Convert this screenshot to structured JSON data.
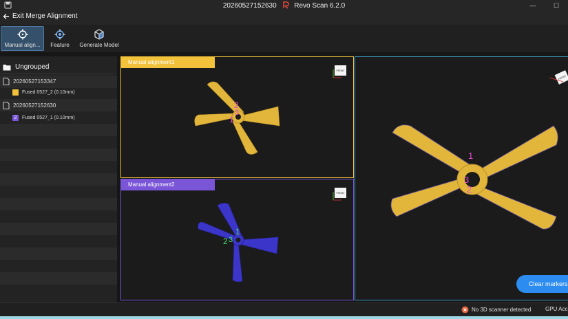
{
  "window": {
    "title": "20260527152630",
    "app_name": "Revo Scan 6.2.0",
    "controls": [
      "minimize-icon",
      "close-icon"
    ]
  },
  "header": {
    "back_label": "Exit Merge Alignment"
  },
  "toolbar": {
    "items": [
      {
        "label": "Manual align...",
        "icon": "crosshair-icon",
        "active": true
      },
      {
        "label": "Feature",
        "icon": "feature-target-icon",
        "active": false
      },
      {
        "label": "Generate Model",
        "icon": "cube-icon",
        "active": false
      }
    ]
  },
  "sidebar": {
    "root_label": "Ungrouped",
    "groups": [
      {
        "name": "20260527153347",
        "item": {
          "badge": "1",
          "label": "Fused 0527_2 (0.10mm)",
          "color": "#f2c23a"
        }
      },
      {
        "name": "20260527152630",
        "item": {
          "badge": "2",
          "label": "Fused 0527_1 (0.10mm)",
          "color": "#7a55d8"
        }
      }
    ]
  },
  "viewports": {
    "top": {
      "label": "Manual alignment1",
      "color": "#f2c23a",
      "markers": [
        "2",
        "3",
        "1"
      ]
    },
    "bottom": {
      "label": "Manual alignment2",
      "color": "#7a55d8",
      "markers": [
        "1",
        "2",
        "3"
      ]
    },
    "combined": {
      "markers": [
        "1",
        "3",
        "2"
      ]
    },
    "cube_label": "FRONT"
  },
  "actions": {
    "clear_markers": "Clear markers"
  },
  "status": {
    "scanner": "No 3D scanner detected",
    "gpu": "GPU Acc"
  },
  "colors": {
    "accent_blue": "#2d8cf0",
    "marker_pink": "#e64bd6",
    "marker_green": "#4cdf6b",
    "model_yellow": "#e2b63a",
    "model_blue": "#3b35c9"
  }
}
